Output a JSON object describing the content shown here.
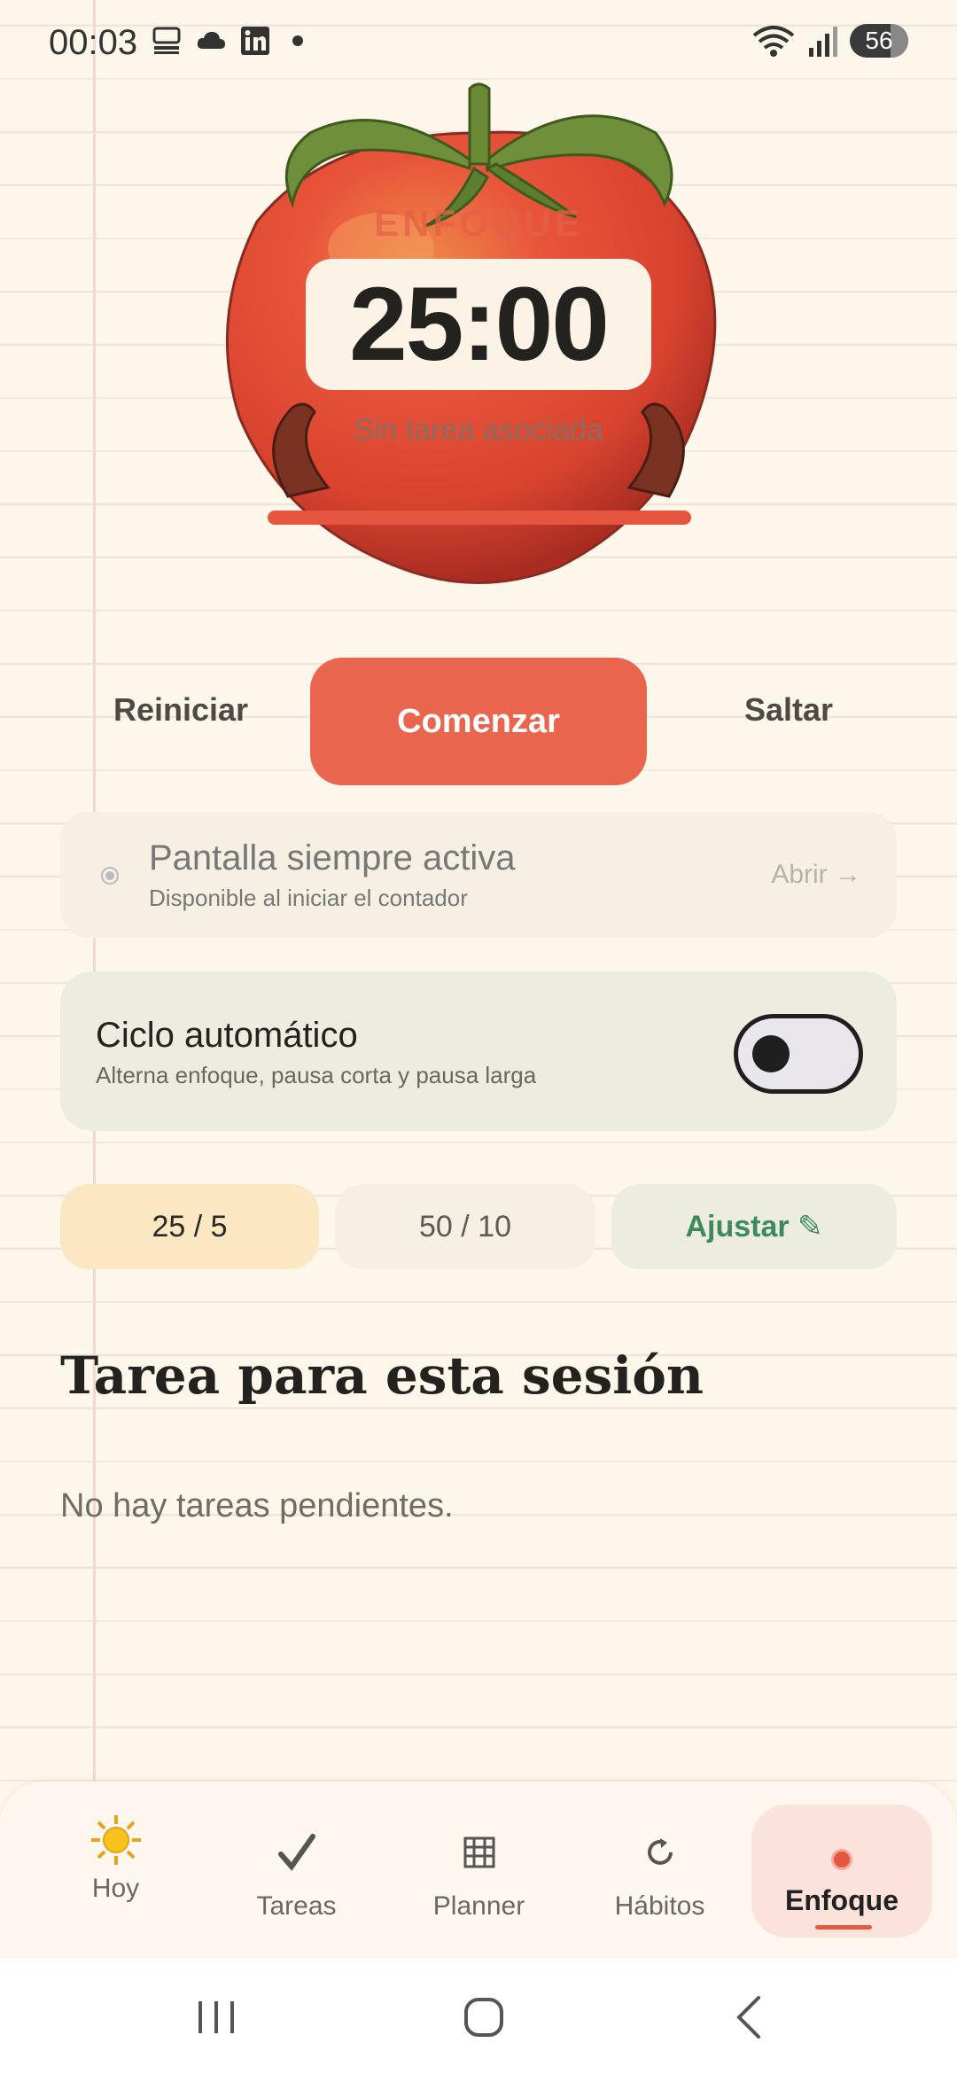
{
  "status_bar": {
    "time": "00:03",
    "battery": "56",
    "icons": [
      "keyboard-icon",
      "cloud-icon",
      "linkedin-icon",
      "notification-dot",
      "wifi-icon",
      "signal-icon",
      "battery-icon"
    ]
  },
  "timer": {
    "mode_label": "ENFOQUE",
    "time": "25:00",
    "task_label": "Sin tarea asociada",
    "progress_fraction": 1.0
  },
  "controls": {
    "reset": "Reiniciar",
    "start": "Comenzar",
    "skip": "Saltar"
  },
  "screen_always_on": {
    "title": "Pantalla siempre activa",
    "subtitle": "Disponible al iniciar el contador",
    "action": "Abrir →"
  },
  "auto_cycle": {
    "title": "Ciclo automático",
    "subtitle": "Alterna enfoque, pausa corta y pausa larga",
    "enabled": false
  },
  "presets": {
    "items": [
      "25 / 5",
      "50 / 10"
    ],
    "selected": "25 / 5",
    "adjust": "Ajustar ✎"
  },
  "task_section": {
    "title": "Tarea para esta sesión",
    "empty": "No hay tareas pendientes."
  },
  "bottom_nav": {
    "items": [
      {
        "label": "Hoy",
        "icon": "sun-icon"
      },
      {
        "label": "Tareas",
        "icon": "check-icon"
      },
      {
        "label": "Planner",
        "icon": "grid-icon"
      },
      {
        "label": "Hábitos",
        "icon": "refresh-icon"
      },
      {
        "label": "Enfoque",
        "icon": "focus-dot-icon"
      }
    ],
    "active": "Enfoque"
  },
  "colors": {
    "accent": "#e9654e",
    "background": "#fdf6ea",
    "preset_selected": "#fbe7c2",
    "adjust_green": "#3d8a5a"
  }
}
